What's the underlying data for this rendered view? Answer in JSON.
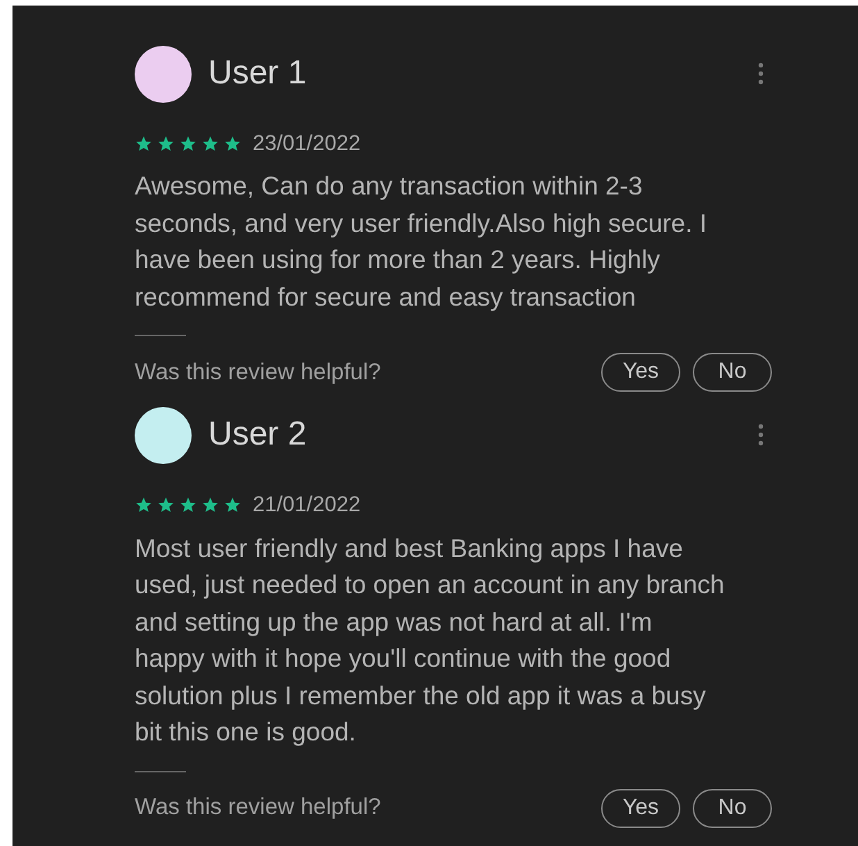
{
  "reviews": [
    {
      "user": "User 1",
      "color": "#ebcdf0",
      "stars": 5,
      "date": "23/01/2022",
      "text": "Awesome, Can do any transaction within 2-3 seconds, and very user friendly.Also high secure. I have been using for more than 2 years. Highly recommend for secure and easy transaction",
      "helpful_prompt": "Was this review helpful?",
      "buttons": [
        "Yes",
        "No"
      ]
    },
    {
      "user": "User 2",
      "color": "#c4eef0",
      "stars": 5,
      "date": "21/01/2022",
      "text": "Most user friendly and best Banking apps I have used, just needed to open an account in any branch and setting up the app was not hard at all. I'm happy with it hope you'll continue with the good solution plus I remember the old app it was a busy bit this one is good.",
      "helpful_prompt": "Was this review helpful?",
      "buttons": [
        "Yes",
        "No"
      ]
    }
  ]
}
